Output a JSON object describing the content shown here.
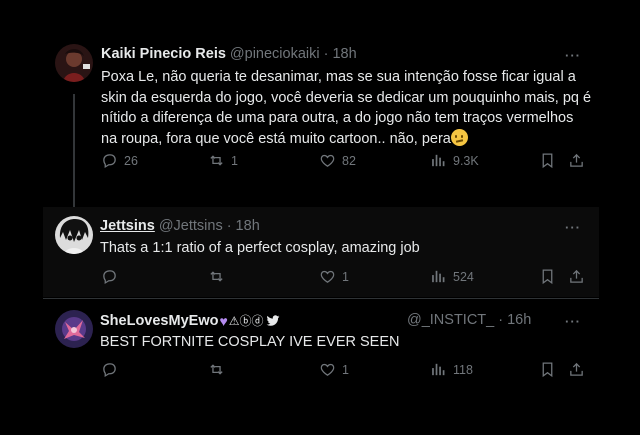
{
  "tweets": [
    {
      "name": "Kaiki Pinecio Reis",
      "handle": "@pineciokaiki",
      "time": "· 18h",
      "text": [
        "Poxa Le, não queria te desanimar, mas se sua intenção fosse ficar igual a",
        "skin da esquerda do jogo, você deveria se dedicar um pouquinho mais, pq é",
        "nítido a diferença de uma para outra, a do jogo não tem traços vermelhos",
        "na roupa, fora que você está muito cartoon.. não, pera"
      ],
      "replies": "26",
      "retweets": "1",
      "likes": "82",
      "views": "9.3K"
    },
    {
      "name": "Jettsins",
      "handle": "@Jettsins",
      "time": "· 18h",
      "text": [
        "Thats a 1:1 ratio of a perfect cosplay, amazing job"
      ],
      "replies": "",
      "retweets": "",
      "likes": "1",
      "views": "524"
    },
    {
      "name": "SheLovesMyEwo",
      "name_symbols": "⚠︎ⓑⓓ",
      "handle": "@_INSTICT_",
      "time": "· 16h",
      "text": [
        "BEST FORTNITE COSPLAY IVE EVER SEEN"
      ],
      "replies": "",
      "retweets": "",
      "likes": "1",
      "views": "118"
    }
  ],
  "more_label": "···",
  "colors": {
    "background": "#000000",
    "text": "#e7e9ea",
    "muted": "#71767b",
    "divider": "#2f3336"
  }
}
